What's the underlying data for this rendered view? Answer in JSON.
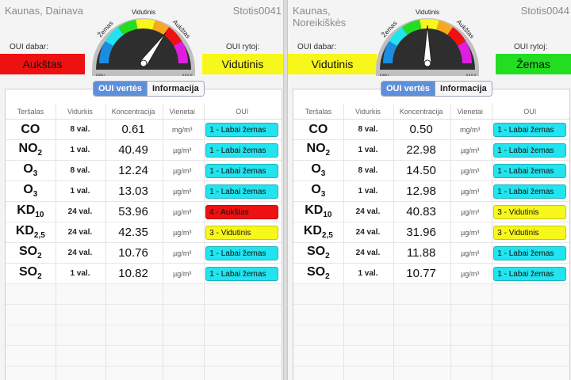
{
  "colors": {
    "level_1": "#22e3ee",
    "level_2": "#f7f71c",
    "level_3": "#f7f71c",
    "level_4": "#ee1111",
    "bar_high": "#ee1111",
    "bar_moderate": "#f7f71c",
    "bar_low": "#22dd22",
    "tab_active": "#5e8fdb"
  },
  "gauge": {
    "min_label": "MIN",
    "max_label": "MAX",
    "segments": [
      "Žemas",
      "Vidutinis",
      "Aukštas"
    ]
  },
  "tabs": {
    "active": "OUI vertės",
    "inactive": "Informacija"
  },
  "columns": [
    "Teršalas",
    "Vidurkis",
    "Koncentracija",
    "Vienetai",
    "OUI"
  ],
  "panels": [
    {
      "station_name": "Kaunas, Dainava",
      "station_id": "Stotis0041",
      "now_label": "OUI dabar:",
      "now_value": "Aukštas",
      "now_color": "#ee1111",
      "tomorrow_label": "OUI rytoj:",
      "tomorrow_value": "Vidutinis",
      "tomorrow_color": "#f7f71c",
      "needle_level": 0.7,
      "rows": [
        {
          "pollutant": "CO",
          "sub": "",
          "avg": "8 val.",
          "conc": "0.61",
          "unit": "mg/m³",
          "aqi": "1 - Labai žemas",
          "level": 1
        },
        {
          "pollutant": "NO",
          "sub": "2",
          "avg": "1 val.",
          "conc": "40.49",
          "unit": "µg/m³",
          "aqi": "1 - Labai žemas",
          "level": 1
        },
        {
          "pollutant": "O",
          "sub": "3",
          "avg": "8 val.",
          "conc": "12.24",
          "unit": "µg/m³",
          "aqi": "1 - Labai žemas",
          "level": 1
        },
        {
          "pollutant": "O",
          "sub": "3",
          "avg": "1 val.",
          "conc": "13.03",
          "unit": "µg/m³",
          "aqi": "1 - Labai žemas",
          "level": 1
        },
        {
          "pollutant": "KD",
          "sub": "10",
          "avg": "24 val.",
          "conc": "53.96",
          "unit": "µg/m³",
          "aqi": "4 - Aukštas",
          "level": 4
        },
        {
          "pollutant": "KD",
          "sub": "2,5",
          "avg": "24 val.",
          "conc": "42.35",
          "unit": "µg/m³",
          "aqi": "3 - Vidutinis",
          "level": 3
        },
        {
          "pollutant": "SO",
          "sub": "2",
          "avg": "24 val.",
          "conc": "10.76",
          "unit": "µg/m³",
          "aqi": "1 - Labai žemas",
          "level": 1
        },
        {
          "pollutant": "SO",
          "sub": "2",
          "avg": "1 val.",
          "conc": "10.82",
          "unit": "µg/m³",
          "aqi": "1 - Labai žemas",
          "level": 1
        }
      ]
    },
    {
      "station_name": "Kaunas, Noreikiškės",
      "station_id": "Stotis0044",
      "now_label": "OUI dabar:",
      "now_value": "Vidutinis",
      "now_color": "#f7f71c",
      "tomorrow_label": "OUI rytoj:",
      "tomorrow_value": "Žemas",
      "tomorrow_color": "#22dd22",
      "needle_level": 0.5,
      "rows": [
        {
          "pollutant": "CO",
          "sub": "",
          "avg": "8 val.",
          "conc": "0.50",
          "unit": "mg/m³",
          "aqi": "1 - Labai žemas",
          "level": 1
        },
        {
          "pollutant": "NO",
          "sub": "2",
          "avg": "1 val.",
          "conc": "22.98",
          "unit": "µg/m³",
          "aqi": "1 - Labai žemas",
          "level": 1
        },
        {
          "pollutant": "O",
          "sub": "3",
          "avg": "8 val.",
          "conc": "14.50",
          "unit": "µg/m³",
          "aqi": "1 - Labai žemas",
          "level": 1
        },
        {
          "pollutant": "O",
          "sub": "3",
          "avg": "1 val.",
          "conc": "12.98",
          "unit": "µg/m³",
          "aqi": "1 - Labai žemas",
          "level": 1
        },
        {
          "pollutant": "KD",
          "sub": "10",
          "avg": "24 val.",
          "conc": "40.83",
          "unit": "µg/m³",
          "aqi": "3 - Vidutinis",
          "level": 3
        },
        {
          "pollutant": "KD",
          "sub": "2,5",
          "avg": "24 val.",
          "conc": "31.96",
          "unit": "µg/m³",
          "aqi": "3 - Vidutinis",
          "level": 3
        },
        {
          "pollutant": "SO",
          "sub": "2",
          "avg": "24 val.",
          "conc": "11.88",
          "unit": "µg/m³",
          "aqi": "1 - Labai žemas",
          "level": 1
        },
        {
          "pollutant": "SO",
          "sub": "2",
          "avg": "1 val.",
          "conc": "10.77",
          "unit": "µg/m³",
          "aqi": "1 - Labai žemas",
          "level": 1
        }
      ]
    }
  ]
}
